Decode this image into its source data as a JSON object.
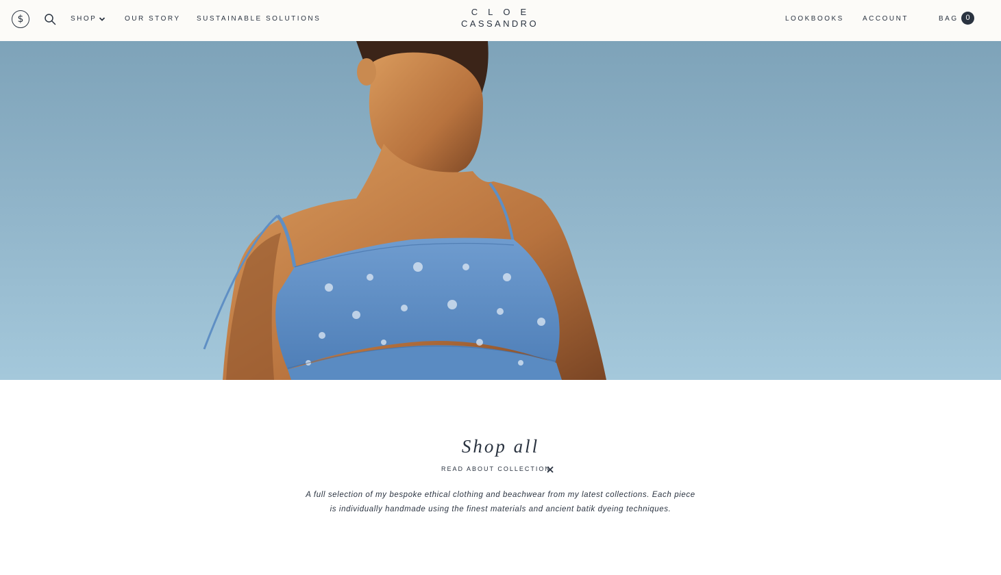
{
  "header": {
    "currency_icon": "dollar-circle-icon",
    "currency_glyph": "$",
    "search_icon": "search-icon",
    "nav_left": [
      {
        "label": "SHOP",
        "has_dropdown": true
      },
      {
        "label": "OUR STORY"
      },
      {
        "label": "SUSTAINABLE SOLUTIONS"
      }
    ],
    "logo": {
      "line1": "CLOE",
      "line2": "CASSANDRO"
    },
    "nav_right": [
      {
        "label": "LOOKBOOKS"
      },
      {
        "label": "ACCOUNT"
      },
      {
        "label": "BAG"
      }
    ],
    "bag_count": "0"
  },
  "hero": {
    "image": "model-in-blue-ruffled-top-against-sky"
  },
  "collection": {
    "title": "Shop all",
    "read_about_label": "READ ABOUT COLLECTION",
    "close_icon": "close-icon",
    "description": "A full selection of my bespoke ethical clothing and beachwear from my latest collections. Each piece is individually handmade using the finest materials and ancient batik dyeing techniques."
  },
  "colors": {
    "text": "#2a3340",
    "header_bg": "#fcfbf8",
    "sky": "#8fb3c8"
  }
}
